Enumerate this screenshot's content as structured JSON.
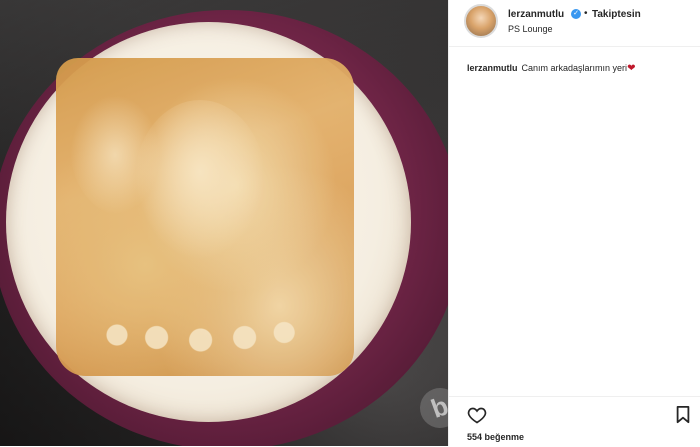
{
  "post": {
    "username": "lerzanmutlu",
    "follow_status": "Takiptesin",
    "location": "PS Lounge",
    "caption_user": "lerzanmutlu",
    "caption_text": "Canım arkadaşlarımın yeri",
    "caption_emoji": "❤",
    "likes_text": "554 beğenme"
  },
  "icons": {
    "verified": "verified-badge-icon",
    "like": "heart-outline-icon",
    "save": "bookmark-icon"
  },
  "colors": {
    "verified": "#3897f0",
    "text": "#262626",
    "emoji_heart": "#c0182b"
  }
}
